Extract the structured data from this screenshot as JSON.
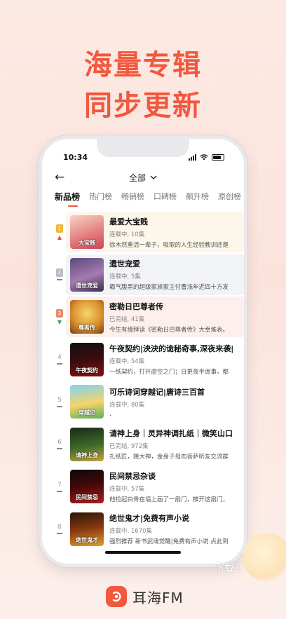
{
  "promo": {
    "line1": "海量专辑",
    "line2": "同步更新"
  },
  "status_bar": {
    "time": "10:34"
  },
  "header": {
    "filter_label": "全部",
    "back_icon": "back-arrow-icon",
    "dropdown_icon": "chevron-down-icon"
  },
  "tabs": [
    "新品榜",
    "热门榜",
    "畅销榜",
    "口碑榜",
    "飙升榜",
    "原创榜"
  ],
  "active_tab": 0,
  "list": [
    {
      "rank": "1",
      "trend": "up",
      "title": "最爱大宝贱",
      "status": "连载中, 10集",
      "desc": "徐木然重活一辈子，吸取的人生经验教训还是",
      "cover_text": "大宝贱"
    },
    {
      "rank": "2",
      "trend": "flat",
      "title": "遗世宠爱",
      "status": "连载中, 5集",
      "desc": "霸气腹黑的超级家族家主付曹浅年近四十方发",
      "cover_text": "遗世宠爱"
    },
    {
      "rank": "3",
      "trend": "down",
      "title": "密勒日巴尊者传",
      "status": "已完结, 41集",
      "desc": "今生有缘拜读《密勒日巴尊者传》大幸难表。",
      "cover_text": "尊者传"
    },
    {
      "rank": "4",
      "trend": "flat",
      "title": "午夜契约|泱泱的诡秘奇事,深夜来袭|",
      "status": "连载中, 54集",
      "desc": "一纸契约，打开虚空之门；日更夜半诡事，都",
      "cover_text": "午夜契约"
    },
    {
      "rank": "5",
      "trend": "flat",
      "title": "可乐诗词穿越记|唐诗三百首",
      "status": "连载中, 80集",
      "desc": ",",
      "cover_text": "穿越记"
    },
    {
      "rank": "6",
      "trend": "flat",
      "title": "请神上身｜灵异神调扎纸｜微笑山口",
      "status": "已完结, 972集",
      "desc": "扎纸匠，跳大神，金身子母肉菩萨听友交流群",
      "cover_text": "请神上身"
    },
    {
      "rank": "7",
      "trend": "flat",
      "title": "民间禁忌杂谈",
      "status": "连载中, 57集",
      "desc": "他捡起白骨在墙上画了一扇门，推开这扇门，",
      "cover_text": "民间禁忌"
    },
    {
      "rank": "8",
      "trend": "flat",
      "title": "绝世鬼才|免费有声小说",
      "status": "连载中, 1670集",
      "desc": "强烈推荐 新书武魂觉醒|免费有声小说 点此到",
      "cover_text": "绝世鬼才"
    }
  ],
  "watermark": "下载汇",
  "brand": {
    "name": "耳海FM"
  },
  "colors": {
    "accent": "#f2583e",
    "row_highlight_1": "#fdf6ea",
    "row_highlight_2": "#f2f3f7",
    "row_highlight_3": "#fdf0ec"
  }
}
